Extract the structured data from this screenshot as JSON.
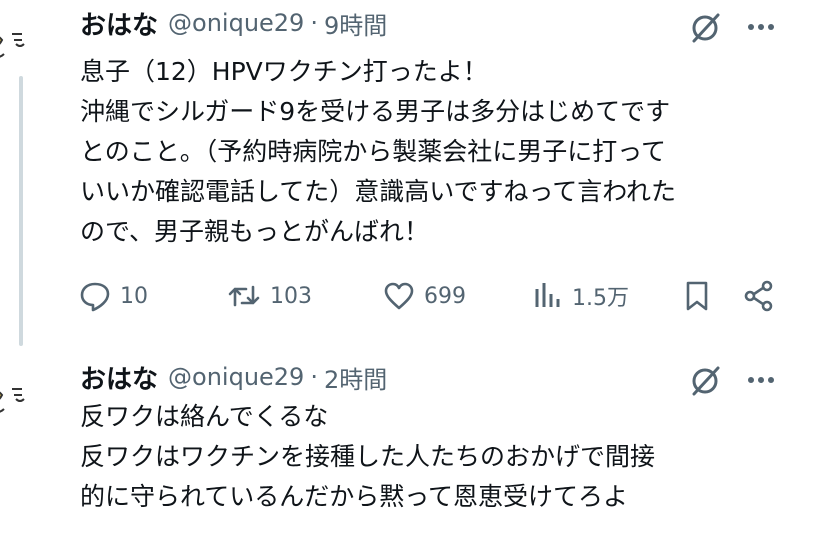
{
  "tweets": [
    {
      "name": "おはな",
      "handle": "@onique29",
      "separator": "·",
      "time": "9時間",
      "lines": [
        "息子（12）HPVワクチン打ったよ！",
        "沖縄でシルガード9を受ける男子は多分はじめてです",
        "とのこと。（予約時病院から製薬会社に男子に打って",
        "いいか確認電話してた）意識高いですねって言われた",
        "ので、男子親もっとがんばれ！"
      ],
      "actions": {
        "reply_count": "10",
        "retweet_count": "103",
        "like_count": "699",
        "view_count": "1.5万"
      }
    },
    {
      "name": "おはな",
      "handle": "@onique29",
      "separator": "·",
      "time": "2時間",
      "lines": [
        "反ワクは絡んでくるな",
        "反ワクはワクチンを接種した人たちのおかげで間接",
        "的に守られているんだから黙って恩恵受けてろよ"
      ]
    }
  ],
  "icons": {
    "more": "more-icon",
    "grok": "slash-circle-icon",
    "reply": "reply-icon",
    "retweet": "retweet-icon",
    "like": "heart-icon",
    "views": "views-icon",
    "bookmark": "bookmark-icon",
    "share": "share-icon"
  },
  "colors": {
    "text": "#0f1419",
    "secondary": "#536471",
    "thread_line": "#cfd9de"
  }
}
